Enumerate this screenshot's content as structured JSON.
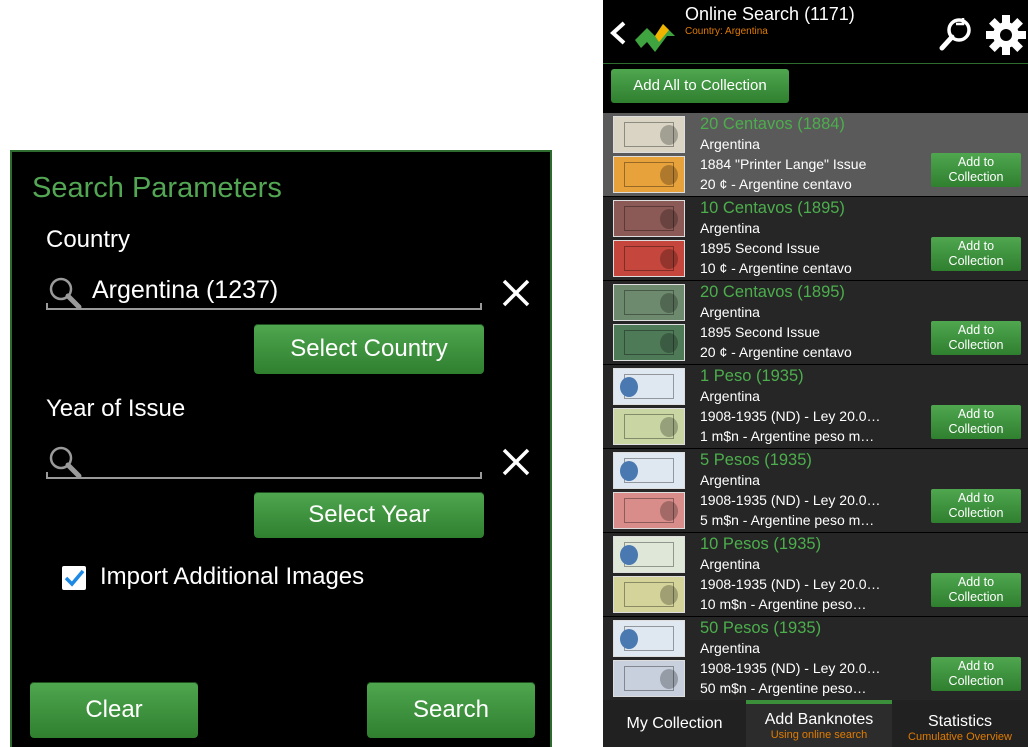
{
  "dialog": {
    "title": "Search Parameters",
    "country_label": "Country",
    "country_value": "Argentina (1237)",
    "select_country_label": "Select Country",
    "year_label": "Year of Issue",
    "year_value": "",
    "select_year_label": "Select Year",
    "import_images_label": "Import Additional Images",
    "import_images_checked": true,
    "clear_label": "Clear",
    "search_label": "Search"
  },
  "app": {
    "title": "Online Search (1171)",
    "subtitle": "Country: Argentina",
    "add_all_label": "Add All to Collection",
    "add_to_label_line1": "Add to",
    "add_to_label_line2": "Collection",
    "items": [
      {
        "name": "20 Centavos (1884)",
        "country": "Argentina",
        "issue": "1884 \"Printer Lange\" Issue",
        "denom": "20 ¢ - Argentine centavo",
        "selected": true
      },
      {
        "name": "10 Centavos (1895)",
        "country": "Argentina",
        "issue": "1895 Second Issue",
        "denom": "10 ¢ - Argentine centavo",
        "selected": false
      },
      {
        "name": "20 Centavos (1895)",
        "country": "Argentina",
        "issue": "1895 Second Issue",
        "denom": "20 ¢ - Argentine centavo",
        "selected": false
      },
      {
        "name": "1 Peso (1935)",
        "country": "Argentina",
        "issue": "1908-1935 (ND) - Ley 20.0…",
        "denom": "1 m$n - Argentine peso m…",
        "selected": false
      },
      {
        "name": "5 Pesos (1935)",
        "country": "Argentina",
        "issue": "1908-1935 (ND) - Ley 20.0…",
        "denom": "5 m$n - Argentine peso m…",
        "selected": false
      },
      {
        "name": "10 Pesos (1935)",
        "country": "Argentina",
        "issue": "1908-1935 (ND) - Ley 20.0…",
        "denom": "10 m$n - Argentine peso…",
        "selected": false
      },
      {
        "name": "50 Pesos (1935)",
        "country": "Argentina",
        "issue": "1908-1935 (ND) - Ley 20.0…",
        "denom": "50 m$n - Argentine peso…",
        "selected": false
      }
    ],
    "tabs": [
      {
        "title": "My Collection",
        "subtitle": ""
      },
      {
        "title": "Add Banknotes",
        "subtitle": "Using online search"
      },
      {
        "title": "Statistics",
        "subtitle": "Cumulative Overview"
      }
    ]
  },
  "colors": {
    "accent_green": "#4cae4c",
    "subtitle_orange": "#e07b00",
    "selected_row": "#5a5a5a",
    "row_bg": "#262626"
  }
}
